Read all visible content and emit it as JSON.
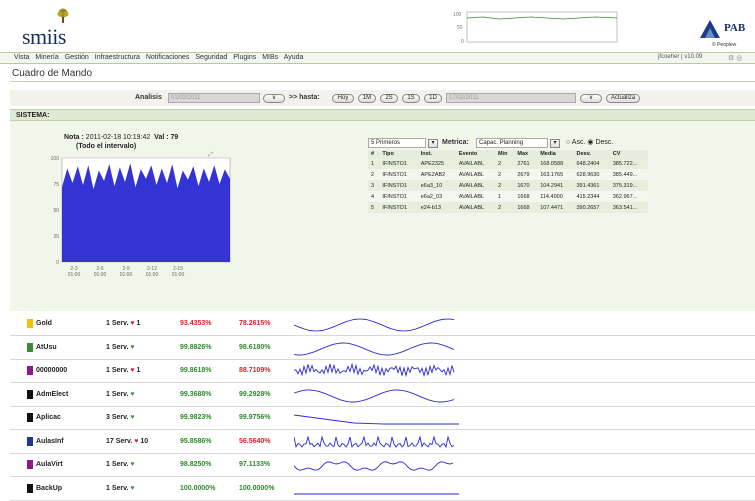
{
  "header": {
    "app_logo_text": "smiis",
    "minichart_ticks": [
      "100",
      "50",
      "0"
    ],
    "brand_text": "PAB",
    "brand_sub": "© Peoplew"
  },
  "menu": {
    "items": [
      "Vista",
      "Minería",
      "Gestión",
      "Infraestructura",
      "Notificaciones",
      "Seguridad",
      "Plugins",
      "MIBs",
      "Ayuda"
    ],
    "user": "jfcoeher | v10.09"
  },
  "page_title": "Cuadro de Mando",
  "toolbar": {
    "analisis_label": "Analisis",
    "start_date": "01/02/2011",
    "hasta_label": ">> hasta:",
    "end_date": "17/02/2011",
    "buttons": [
      "Hoy",
      "1M",
      "2S",
      "1S",
      "1D"
    ],
    "update_button": "Actualiza"
  },
  "section": {
    "label": "SISTEMA:"
  },
  "note": {
    "prefix": "Nota :",
    "timestamp": "2011-02-18 10:19:42",
    "val_label": "Val :",
    "val": "79",
    "subtitle": "(Todo el intervalo)"
  },
  "bigchart": {
    "y_ticks": [
      "100",
      "75",
      "50",
      "25",
      "0"
    ],
    "x_ticks": [
      [
        "2-3",
        "01:00"
      ],
      [
        "2-6",
        "01:00"
      ],
      [
        "2-9",
        "01:00"
      ],
      [
        "2-12",
        "01:00"
      ],
      [
        "2-15",
        "01:00"
      ]
    ]
  },
  "chart_data": {
    "type": "area",
    "title": "",
    "xlabel": "",
    "ylabel": "",
    "ylim": [
      0,
      100
    ],
    "x": [
      "2-3 01:00",
      "2-6 01:00",
      "2-9 01:00",
      "2-12 01:00",
      "2-15 01:00"
    ],
    "series": [
      {
        "values": [
          72,
          90,
          76,
          92,
          74,
          93,
          70,
          88,
          78,
          94,
          73,
          91,
          77,
          95,
          72,
          89,
          80,
          93,
          74,
          90,
          76,
          94,
          71,
          88,
          79,
          92,
          73,
          90,
          77,
          93,
          75,
          89,
          80
        ]
      }
    ]
  },
  "ranking": {
    "top_select": "5 Primeros",
    "metric_label": "Metrica:",
    "metric_select": "Capac. Planning",
    "asc_label": "Asc.",
    "desc_label": "Desc.",
    "columns": [
      "#",
      "Tipo",
      "Inst.",
      "Evento",
      "Min",
      "Max",
      "Media",
      "Desv.",
      "CV"
    ],
    "rows": [
      [
        "1",
        "IFINSTO1",
        "APE2325",
        "AVAILABL",
        "2",
        "2761",
        "168.0588",
        "648.2404",
        "385.722..."
      ],
      [
        "2",
        "IFINSTO1",
        "APE2AB2",
        "AVAILABL",
        "2",
        "2679",
        "163.1765",
        "628.9630",
        "385.449..."
      ],
      [
        "3",
        "IFINSTO1",
        "e6a3_10",
        "AVAILABL",
        "2",
        "1670",
        "104.2941",
        "391.4361",
        "375.319..."
      ],
      [
        "4",
        "IFINSTO1",
        "e6a2_03",
        "AVAILABL",
        "1",
        "1668",
        "114.4000",
        "415.2344",
        "362.967..."
      ],
      [
        "5",
        "IFINSTO1",
        "e24-b13",
        "AVAILABL",
        "2",
        "1668",
        "107.4471",
        "390.2657",
        "363.541..."
      ]
    ]
  },
  "items": [
    {
      "name": "Gold",
      "color": "#f2c200",
      "serv": "1 Serv.",
      "alert": true,
      "alert_count": "1",
      "p1": "93.4353%",
      "p1_color": "red",
      "p2": "78.2615%",
      "p2_color": "red",
      "spark": "wave"
    },
    {
      "name": "AtUsu",
      "color": "#3a8a3a",
      "serv": "1 Serv.",
      "alert": false,
      "alert_count": "",
      "p1": "99.8826%",
      "p1_color": "green",
      "p2": "98.6180%",
      "p2_color": "green",
      "spark": "wave"
    },
    {
      "name": "00000000",
      "color": "#8a1b8a",
      "serv": "1 Serv.",
      "alert": true,
      "alert_count": "1",
      "p1": "99.8618%",
      "p1_color": "green",
      "p2": "88.7109%",
      "p2_color": "red",
      "spark": "dense"
    },
    {
      "name": "AdmElect",
      "color": "#111111",
      "serv": "1 Serv.",
      "alert": false,
      "alert_count": "",
      "p1": "99.3688%",
      "p1_color": "green",
      "p2": "99.2928%",
      "p2_color": "green",
      "spark": "wave"
    },
    {
      "name": "Aplicac",
      "color": "#111111",
      "serv": "3 Serv.",
      "alert": false,
      "alert_count": "",
      "p1": "99.9823%",
      "p1_color": "green",
      "p2": "99.9756%",
      "p2_color": "green",
      "spark": "flatdrop"
    },
    {
      "name": "AulasInf",
      "color": "#1b3a8a",
      "serv": "17 Serv.",
      "alert": true,
      "alert_count": "10",
      "p1": "95.8586%",
      "p1_color": "green",
      "p2": "56.5640%",
      "p2_color": "red",
      "spark": "spiky"
    },
    {
      "name": "AulaVirt",
      "color": "#8a1b8a",
      "serv": "1 Serv.",
      "alert": false,
      "alert_count": "",
      "p1": "98.8250%",
      "p1_color": "green",
      "p2": "97.1133%",
      "p2_color": "green",
      "spark": "wave2"
    },
    {
      "name": "BackUp",
      "color": "#111111",
      "serv": "1 Serv.",
      "alert": false,
      "alert_count": "",
      "p1": "100.0000%",
      "p1_color": "green",
      "p2": "100.0000%",
      "p2_color": "green",
      "spark": "flat"
    }
  ]
}
